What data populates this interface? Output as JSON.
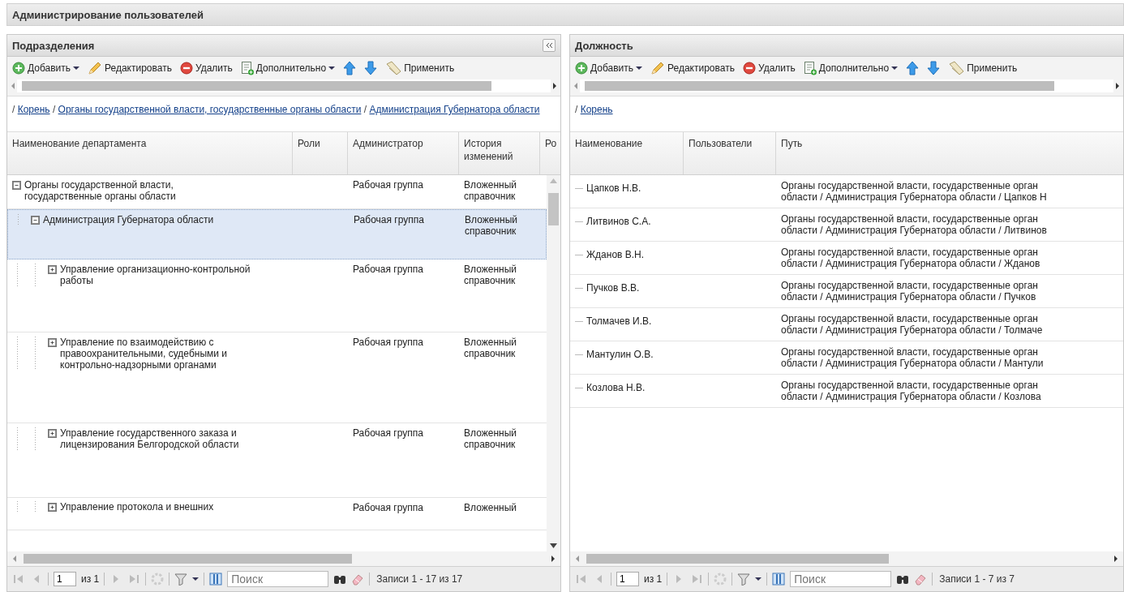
{
  "window": {
    "title": "Администрирование пользователей"
  },
  "departments_panel": {
    "title": "Подразделения",
    "toolbar": [
      {
        "kind": "add",
        "label": "Добавить",
        "menu": true
      },
      {
        "kind": "edit",
        "label": "Редактировать"
      },
      {
        "kind": "delete",
        "label": "Удалить"
      },
      {
        "kind": "more",
        "label": "Дополнительно",
        "menu": true
      },
      {
        "kind": "up"
      },
      {
        "kind": "down"
      },
      {
        "kind": "apply",
        "label": "Применить"
      }
    ],
    "breadcrumb_separator": "/",
    "breadcrumb": [
      "Корень",
      "Органы государственной власти, государственные органы области",
      "Администрация Губернатора области"
    ],
    "columns": [
      "Наименование департамента",
      "Роли",
      "Администратор",
      "История изменений",
      "Ро"
    ],
    "rows": [
      {
        "name": "Органы государственной власти, государственные органы области",
        "admin": "Рабочая группа",
        "history": "Вложенный справочник",
        "expanded": true,
        "selected": false,
        "children": [
          {
            "name": "Администрация Губернатора области",
            "admin": "Рабочая группа",
            "history": "Вложенный справочник",
            "expanded": true,
            "selected": true,
            "children": [
              {
                "name": "Управление организационно-контрольной работы",
                "admin": "Рабочая группа",
                "history": "Вложенный справочник",
                "expanded": false,
                "selected": false
              },
              {
                "name": "Управление по взаимодействию с правоохранительными, судебными и контрольно-надзорными органами",
                "admin": "Рабочая группа",
                "history": "Вложенный справочник",
                "expanded": false,
                "selected": false
              },
              {
                "name": "Управление государственного заказа и лицензирования Белгородской области",
                "admin": "Рабочая группа",
                "history": "Вложенный справочник",
                "expanded": false,
                "selected": false
              },
              {
                "name": "Управление протокола и внешних",
                "admin": "Рабочая группа",
                "history": "Вложенный",
                "expanded": false,
                "selected": false
              }
            ]
          }
        ]
      }
    ],
    "pager": {
      "page": "1",
      "of": "из 1",
      "search_placeholder": "Поиск",
      "summary": "Записи 1 - 17 из 17"
    }
  },
  "positions_panel": {
    "title": "Должность",
    "toolbar": [
      {
        "kind": "add",
        "label": "Добавить",
        "menu": true
      },
      {
        "kind": "edit",
        "label": "Редактировать"
      },
      {
        "kind": "delete",
        "label": "Удалить"
      },
      {
        "kind": "more",
        "label": "Дополнительно",
        "menu": true
      },
      {
        "kind": "up"
      },
      {
        "kind": "down"
      },
      {
        "kind": "apply",
        "label": "Применить"
      }
    ],
    "breadcrumb_separator": "/",
    "breadcrumb": [
      "Корень"
    ],
    "columns": [
      "Наименование",
      "Пользователи",
      "Путь"
    ],
    "rows": [
      {
        "name": "Цапков Н.В.",
        "path": [
          "Органы государственной власти, государственные орган",
          "области / Администрация Губернатора области / Цапков Н"
        ]
      },
      {
        "name": "Литвинов С.А.",
        "path": [
          "Органы государственной власти, государственные орган",
          "области / Администрация Губернатора области / Литвинов"
        ]
      },
      {
        "name": "Жданов В.Н.",
        "path": [
          "Органы государственной власти, государственные орган",
          "области / Администрация Губернатора области / Жданов"
        ]
      },
      {
        "name": "Пучков В.В.",
        "path": [
          "Органы государственной власти, государственные орган",
          "области / Администрация Губернатора области / Пучков"
        ]
      },
      {
        "name": "Толмачев И.В.",
        "path": [
          "Органы государственной власти, государственные орган",
          "области / Администрация Губернатора области / Толмаче"
        ]
      },
      {
        "name": "Мантулин О.В.",
        "path": [
          "Органы государственной власти, государственные орган",
          "области / Администрация Губернатора области / Мантули"
        ]
      },
      {
        "name": "Козлова Н.В.",
        "path": [
          "Органы государственной власти, государственные орган",
          "области / Администрация Губернатора области / Козлова"
        ]
      }
    ],
    "pager": {
      "page": "1",
      "of": "из 1",
      "search_placeholder": "Поиск",
      "summary": "Записи 1 - 7 из 7"
    }
  }
}
